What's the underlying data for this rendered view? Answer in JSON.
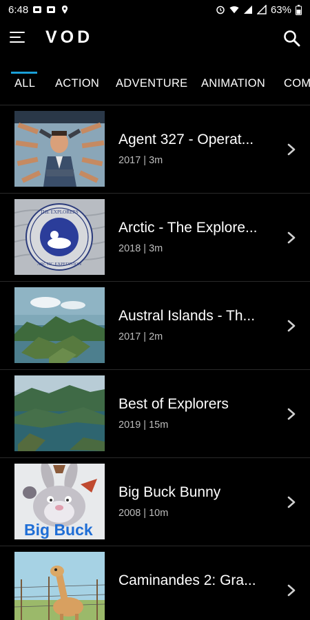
{
  "status": {
    "time": "6:48",
    "battery": "63%"
  },
  "appbar": {
    "title": "VOD",
    "menu_icon": "hamburger-menu-icon",
    "search_icon": "search-icon"
  },
  "tabs": [
    {
      "label": "ALL",
      "selected": true
    },
    {
      "label": "ACTION",
      "selected": false
    },
    {
      "label": "ADVENTURE",
      "selected": false
    },
    {
      "label": "ANIMATION",
      "selected": false
    },
    {
      "label": "COM",
      "selected": false
    }
  ],
  "colors": {
    "accent": "#1aa0d8",
    "background": "#000000",
    "divider": "#2a2a2a",
    "meta_text": "#bdbdbd"
  },
  "items": [
    {
      "title": "Agent 327 - Operat...",
      "meta": "2017 | 3m"
    },
    {
      "title": "Arctic - The Explore...",
      "meta": "2018 | 3m"
    },
    {
      "title": "Austral Islands - Th...",
      "meta": "2017 | 2m"
    },
    {
      "title": "Best of Explorers",
      "meta": "2019 | 15m"
    },
    {
      "title": "Big Buck Bunny",
      "meta": "2008 | 10m"
    },
    {
      "title": "Caminandes 2: Gra...",
      "meta": ""
    }
  ],
  "thumbnail_text": {
    "arctic_seal_top": "THE EXPLORERS",
    "arctic_seal_bottom": "ARCTIC EXPEDITION",
    "bunny_logo": "Big Buck"
  }
}
